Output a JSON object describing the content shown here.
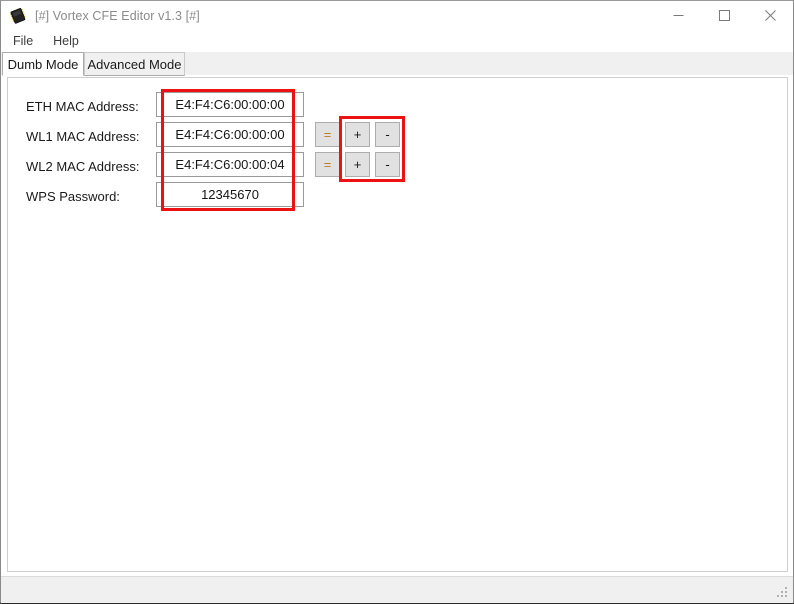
{
  "window": {
    "title": "[#] Vortex CFE Editor v1.3 [#]",
    "icon": "ic-chip-icon",
    "controls": {
      "minimize": "minimize-icon",
      "maximize": "maximize-icon",
      "close": "close-icon"
    }
  },
  "menu": {
    "items": [
      {
        "label": "File"
      },
      {
        "label": "Help"
      }
    ]
  },
  "tabs": [
    {
      "label": "Dumb Mode",
      "selected": true
    },
    {
      "label": "Advanced Mode",
      "selected": false
    }
  ],
  "form": {
    "rows": [
      {
        "label": "ETH MAC Address:",
        "value": "E4:F4:C6:00:00:00",
        "placeholder": ""
      },
      {
        "label": "WL1 MAC Address:",
        "value": "E4:F4:C6:00:00:00",
        "placeholder": ""
      },
      {
        "label": "WL2 MAC Address:",
        "value": "E4:F4:C6:00:00:04",
        "placeholder": ""
      },
      {
        "label": "WPS Password:",
        "value": "12345670",
        "placeholder": ""
      }
    ],
    "buttons": {
      "equals": "=",
      "plus": "+",
      "minus": "-"
    }
  },
  "annotations": {
    "fields_box": "highlight-fields",
    "buttons_box": "highlight-buttons",
    "color": "#ee1111"
  },
  "statusbar": {
    "text": "",
    "grip": "resize-grip-icon"
  }
}
